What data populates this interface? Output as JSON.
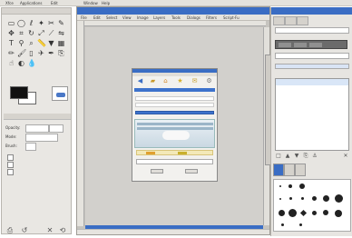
{
  "menubar": {
    "items": [
      "Xfce",
      "Applications",
      "Edit",
      "Window",
      "Help"
    ]
  },
  "image_window": {
    "title": "[Image] - GIMP Window",
    "menu": [
      "File",
      "Edit",
      "Select",
      "View",
      "Image",
      "Layers",
      "Tools",
      "Dialogs",
      "Filters",
      "Script-Fu"
    ],
    "status_text": "px  100%  Screenshot.png"
  },
  "dock": {
    "title": "Layers, Channels",
    "list_selected": "Background"
  },
  "toolbox": {
    "tool_options_tab": "Tool Options",
    "options": [
      {
        "label": "Opacity:",
        "value": "100"
      },
      {
        "label": "Mode:",
        "value": "Normal"
      },
      {
        "label": "Brush:",
        "value": "Circle"
      }
    ],
    "checks": [
      "Fade out",
      "Incremental",
      "Use color from gradient"
    ]
  }
}
